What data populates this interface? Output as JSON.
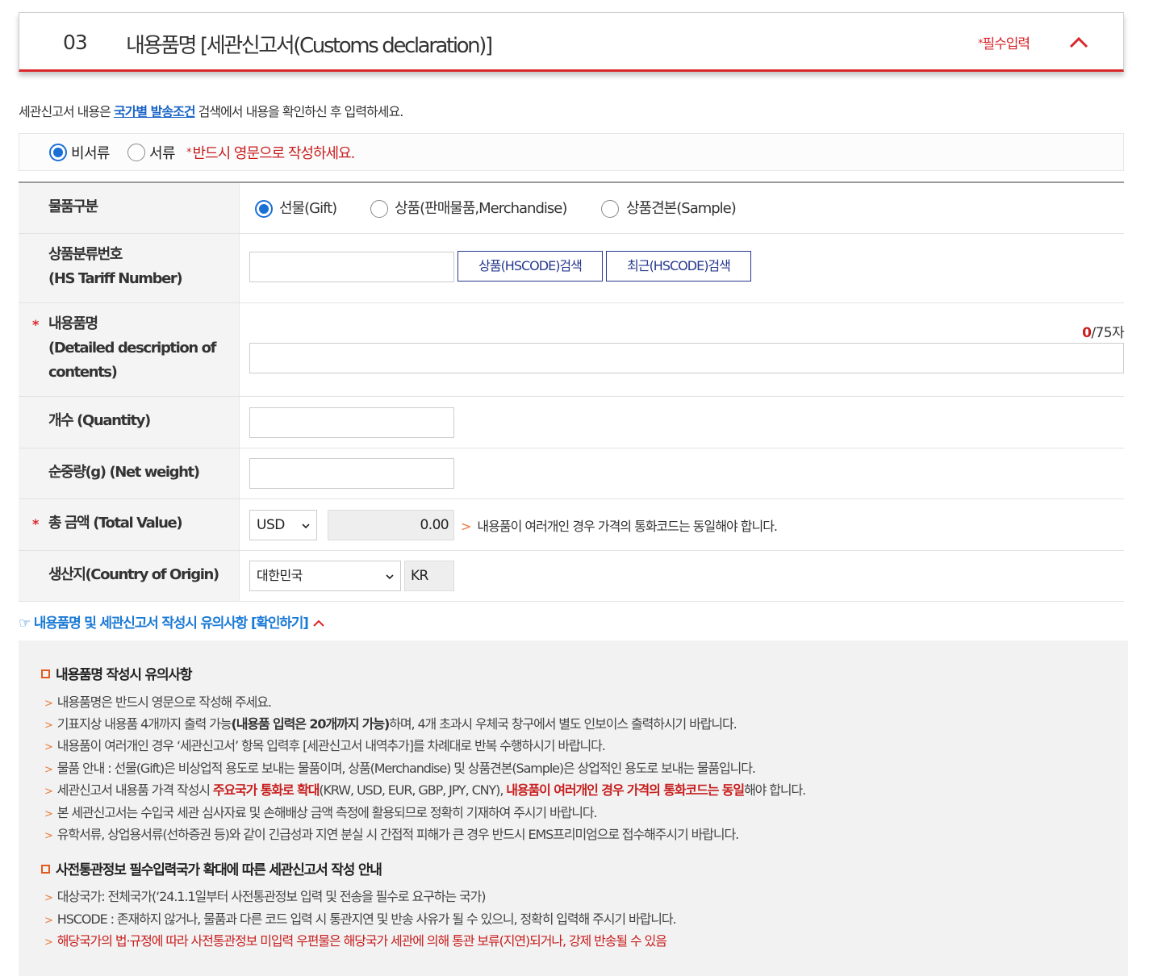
{
  "header": {
    "number": "03",
    "title": "내용품명 [세관신고서(Customs declaration)]",
    "required_star": "*",
    "required_label": "필수입력"
  },
  "intro": {
    "before": "세관신고서 내용은 ",
    "link": "국가별 발송조건",
    "after": " 검색에서 내용을 확인하신 후 입력하세요."
  },
  "doc_type": {
    "options": [
      "비서류",
      "서류"
    ],
    "selected": "비서류",
    "warning_star": "*",
    "warning": "반드시 영문으로 작성하세요."
  },
  "form": {
    "item_type": {
      "label": "물품구분",
      "options": [
        "선물(Gift)",
        "상품(판매물품,Merchandise)",
        "상품견본(Sample)"
      ],
      "selected": "선물(Gift)"
    },
    "hs_code": {
      "label_line1": "상품분류번호",
      "label_line2": "(HS Tariff Number)",
      "value": "",
      "btn_product": "상품(HSCODE)검색",
      "btn_recent": "최근(HSCODE)검색"
    },
    "description": {
      "required": "*",
      "label_line1": "내용품명",
      "label_line2": "(Detailed description of",
      "label_line3": "contents)",
      "count_current": "0",
      "count_max": "/75자",
      "value": ""
    },
    "quantity": {
      "label": "개수 (Quantity)",
      "value": ""
    },
    "net_weight": {
      "label": "순중량(g) (Net weight)",
      "value": ""
    },
    "total_value": {
      "required": "*",
      "label": "총 금액 (Total Value)",
      "currency": "USD",
      "amount": "0.00",
      "hint_marker": ">",
      "hint": "내용품이 여러개인 경우 가격의 통화코드는 동일해야 합니다."
    },
    "origin": {
      "label": "생산지(Country of Origin)",
      "country": "대한민국",
      "code": "KR"
    }
  },
  "notice": {
    "toggle_label": "☞ 내용품명 및 세관신고서 작성시 유의사항 [확인하기]",
    "section1_title": "내용품명 작성시 유의사항",
    "marker": ">",
    "s1_line1": "내용품명은 반드시 영문으로 작성해 주세요.",
    "s1_line2_a": "기표지상 내용품 4개까지 출력 가능",
    "s1_line2_b": "(내용품 입력은 20개까지 가능)",
    "s1_line2_c": "하며, 4개 초과시 우체국 창구에서 별도 인보이스 출력하시기 바랍니다.",
    "s1_line3": "내용품이 여러개인 경우 ‘세관신고서’ 항목 입력후 [세관신고서 내역추가]를 차례대로 반복 수행하시기 바랍니다.",
    "s1_line4": "물품 안내 : 선물(Gift)은 비상업적 용도로 보내는 물품이며, 상품(Merchandise) 및 상품견본(Sample)은 상업적인 용도로 보내는 물품입니다.",
    "s1_line5_a": "세관신고서 내용품 가격 작성시 ",
    "s1_line5_b": "주요국가 통화로 확대",
    "s1_line5_c": "(KRW, USD, EUR, GBP, JPY, CNY), ",
    "s1_line5_d": "내용품이 여러개인 경우 가격의 통화코드는 동일",
    "s1_line5_e": "해야 합니다.",
    "s1_line6": "본 세관신고서는 수입국 세관 심사자료 및 손해배상 금액 측정에 활용되므로 정확히 기재하여 주시기 바랍니다.",
    "s1_line7": "유학서류, 상업용서류(선하증권 등)와 같이 긴급성과 지연 분실 시 간접적 피해가 큰 경우 반드시 EMS프리미엄으로 접수해주시기 바랍니다.",
    "section2_title": "사전통관정보 필수입력국가 확대에 따른 세관신고서 작성 안내",
    "s2_line1": "대상국가: 전체국가(‘24.1.1일부터 사전통관정보 입력 및 전송을 필수로 요구하는 국가)",
    "s2_line2": "HSCODE : 존재하지 않거나, 물품과 다른 코드 입력 시 통관지연 및 반송 사유가 될 수 있으니, 정확히 입력해 주시기 바랍니다.",
    "s2_line3": "해당국가의 법·규정에 따라 사전통관정보 미입력 우편물은 해당국가 세관에 의해 통관 보류(지연)되거나, 강제 반송될 수 있음"
  },
  "colors": {
    "accent_red": "#d9262b",
    "link_blue": "#1a64c8",
    "button_navy": "#27388e",
    "radio_blue": "#1a6fd6"
  }
}
